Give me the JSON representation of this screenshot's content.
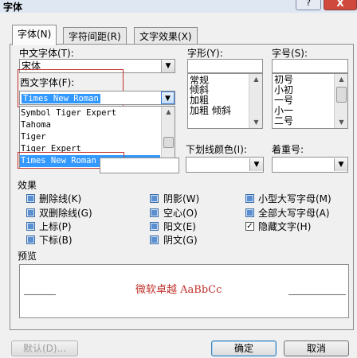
{
  "window": {
    "title": "字体",
    "help_label": "?",
    "close_label": "X"
  },
  "tabs": [
    {
      "label": "字体(N)"
    },
    {
      "label": "字符间距(R)"
    },
    {
      "label": "文字效果(X)"
    }
  ],
  "font": {
    "chinese_label": "中文字体(T):",
    "chinese_value": "宋体",
    "western_label": "西文字体(F):",
    "western_value": "Times New Roman",
    "dropdown_items": [
      "Symbol Tiger Expert",
      "Tahoma",
      "Tiger",
      "Tiger Expert",
      "Times New Roman"
    ],
    "selected_item": "Times New Roman"
  },
  "style": {
    "label": "字形(Y):",
    "items": [
      "常规",
      "倾斜",
      "加粗",
      "加粗 倾斜"
    ]
  },
  "size": {
    "label": "字号(S):",
    "items": [
      "初号",
      "小初",
      "一号",
      "小一",
      "二号"
    ]
  },
  "underline_color": {
    "label": "下划线颜色(I):"
  },
  "emphasis": {
    "label": "着重号:"
  },
  "effects": {
    "label": "效果",
    "col1": [
      {
        "label": "删除线(K)",
        "checked": false
      },
      {
        "label": "双删除线(G)",
        "checked": false
      },
      {
        "label": "上标(P)",
        "checked": false
      },
      {
        "label": "下标(B)",
        "checked": false
      }
    ],
    "col2": [
      {
        "label": "阴影(W)",
        "checked": false
      },
      {
        "label": "空心(O)",
        "checked": false
      },
      {
        "label": "阳文(E)",
        "checked": false
      },
      {
        "label": "阴文(G)",
        "checked": false
      }
    ],
    "col3": [
      {
        "label": "小型大写字母(M)",
        "checked": false
      },
      {
        "label": "全部大写字母(A)",
        "checked": false
      },
      {
        "label": "隐藏文字(H)",
        "checked": true,
        "mark": "✓"
      }
    ]
  },
  "preview": {
    "label": "预览",
    "sample_text": "微软卓越 AaBbCc",
    "sample_color": "#c0322b"
  },
  "buttons": {
    "default": "默认(D)...",
    "ok": "确定",
    "cancel": "取消"
  },
  "colors": {
    "selection": "#3399ff",
    "highlight_box": "#c0322b"
  }
}
